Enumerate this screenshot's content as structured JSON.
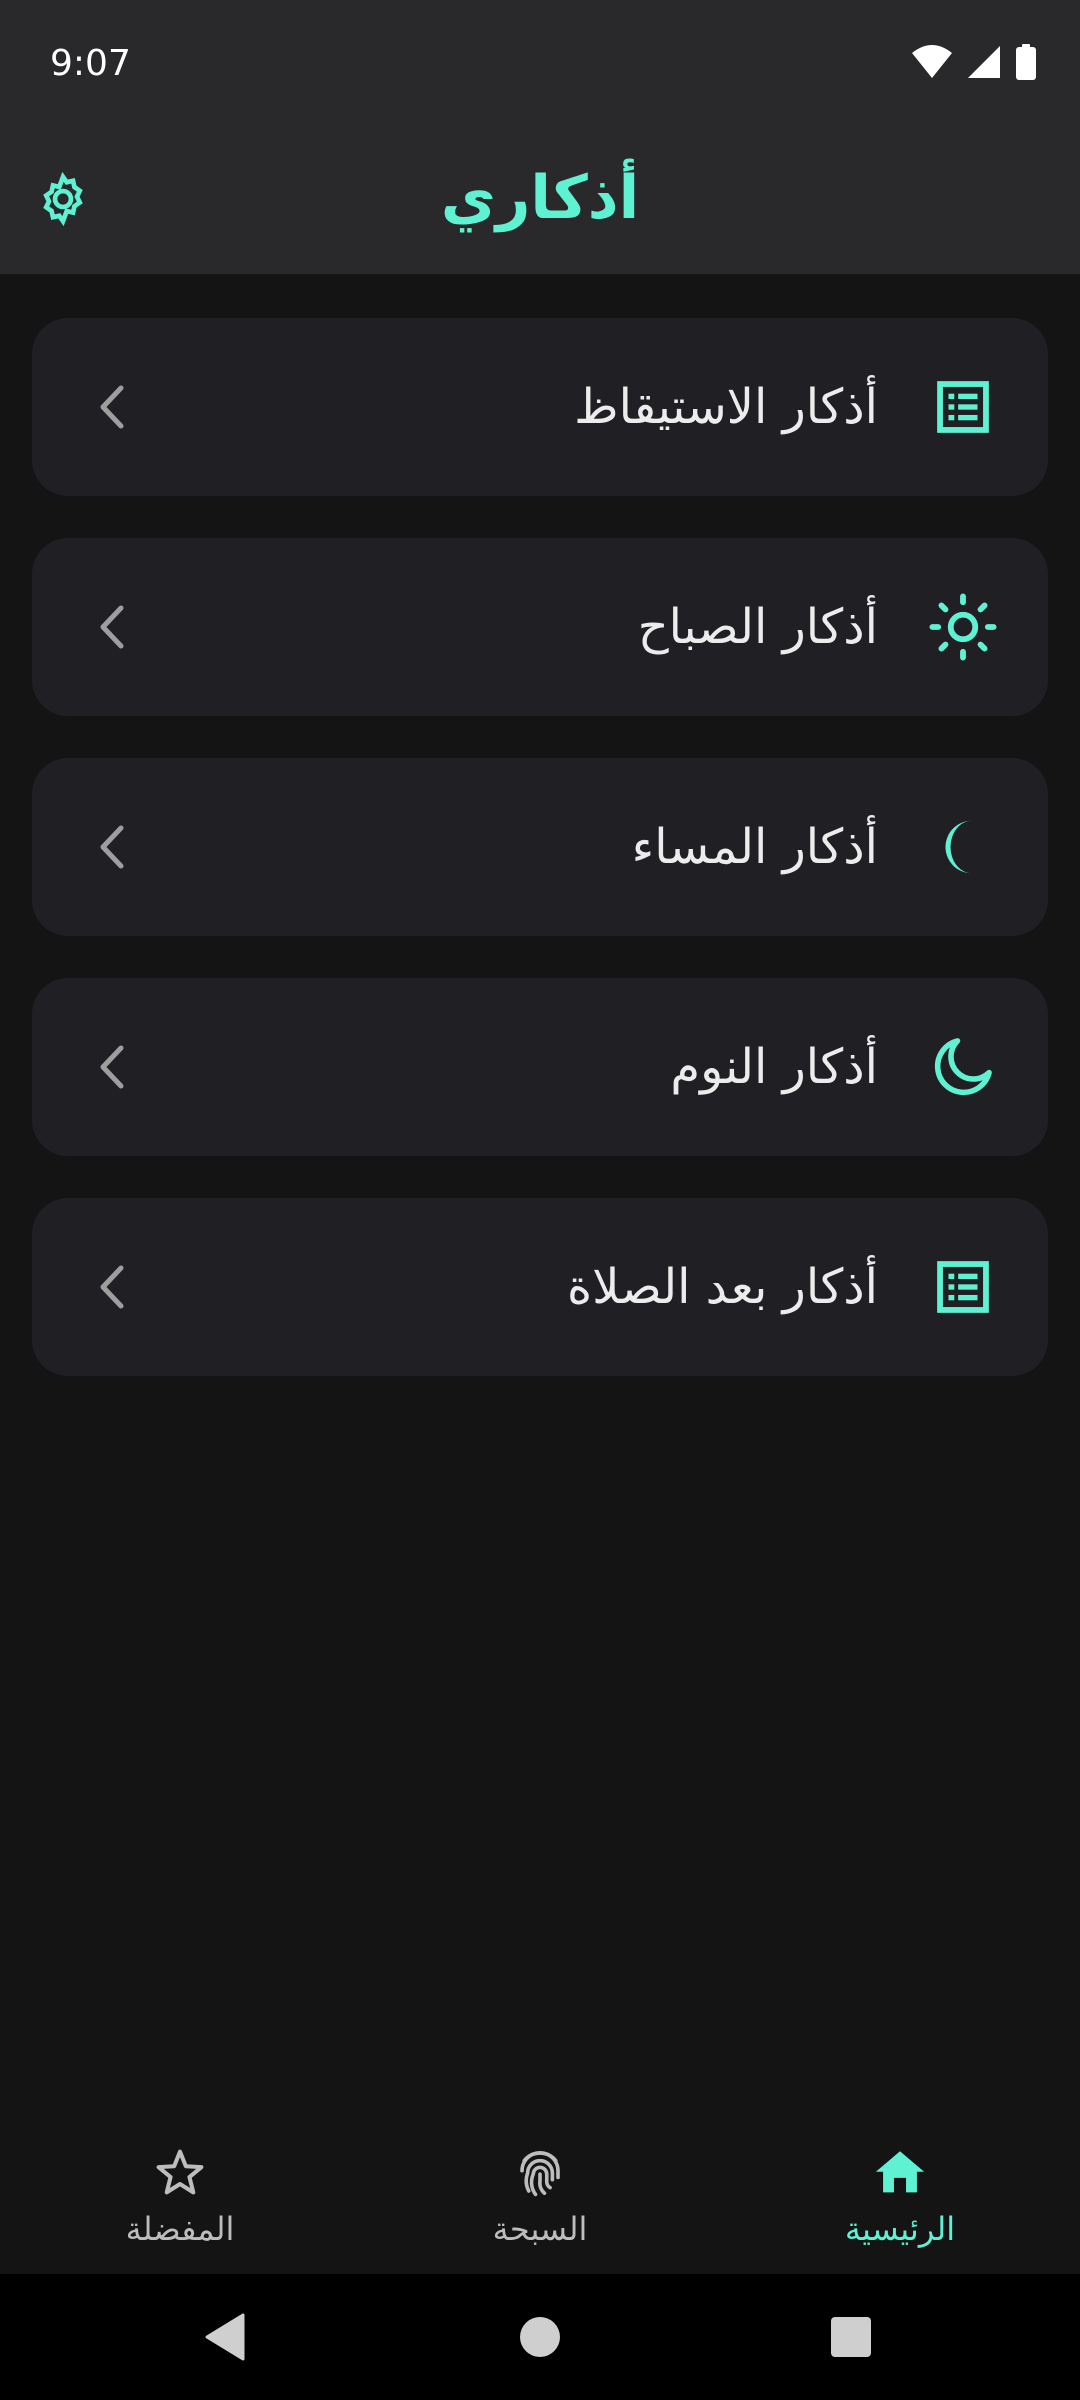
{
  "status_bar": {
    "time": "9:07",
    "icons": [
      "wifi-icon",
      "signal-icon",
      "battery-icon"
    ]
  },
  "app_bar": {
    "title": "أذكاري",
    "settings_icon": "gear-icon"
  },
  "colors": {
    "accent": "#5ff2d2",
    "background": "#141415",
    "bar": "#29292b",
    "card": "#201f23",
    "text": "#ececec",
    "muted": "#bdbdbd"
  },
  "list": {
    "items": [
      {
        "label": "أذكار الاستيقاظ",
        "icon": "list-document-icon"
      },
      {
        "label": "أذكار الصباح",
        "icon": "sun-icon"
      },
      {
        "label": "أذكار المساء",
        "icon": "crescent-filled-icon"
      },
      {
        "label": "أذكار النوم",
        "icon": "moon-outline-icon"
      },
      {
        "label": "أذكار بعد الصلاة",
        "icon": "list-document-icon"
      }
    ]
  },
  "bottom_nav": {
    "items": [
      {
        "label": "المفضلة",
        "icon": "star-icon",
        "active": false
      },
      {
        "label": "السبحة",
        "icon": "fingerprint-icon",
        "active": false
      },
      {
        "label": "الرئيسية",
        "icon": "home-icon",
        "active": true
      }
    ]
  },
  "system_nav": {
    "buttons": [
      "back-icon",
      "home-circle-icon",
      "recents-icon"
    ]
  }
}
